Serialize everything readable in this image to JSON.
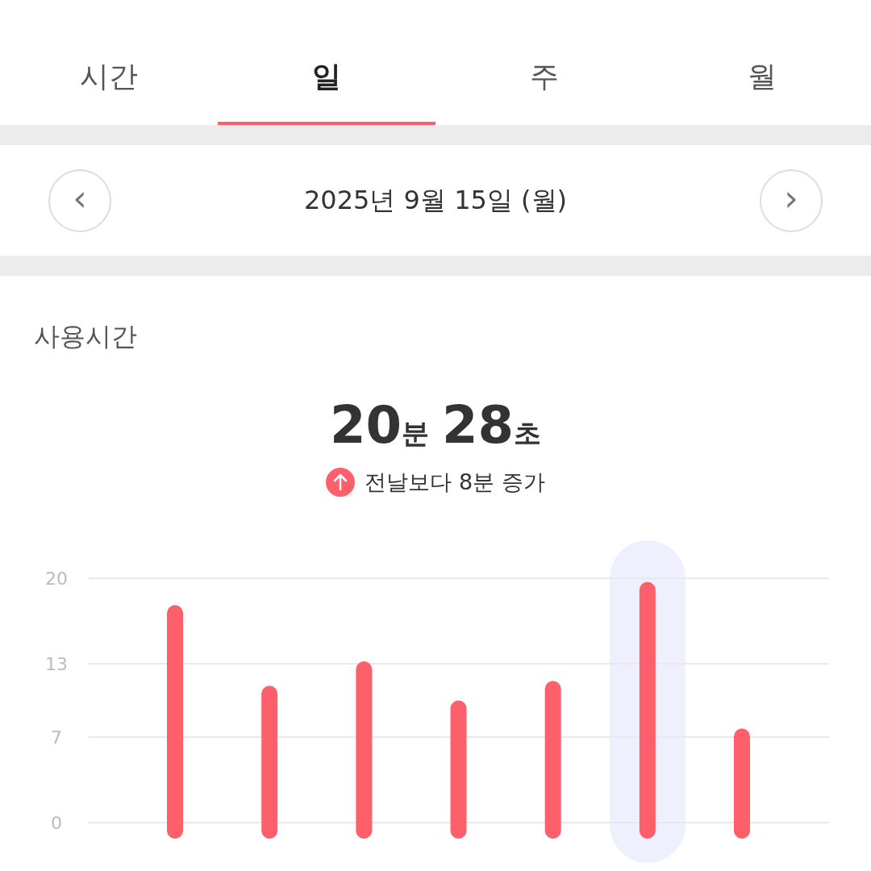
{
  "tabs": [
    {
      "label": "시간",
      "selected": false
    },
    {
      "label": "일",
      "selected": true
    },
    {
      "label": "주",
      "selected": false
    },
    {
      "label": "월",
      "selected": false
    }
  ],
  "date_nav": {
    "prev": "‹",
    "date": "2025년 9월 15일 (월)",
    "next": "›"
  },
  "usage": {
    "title": "사용시간",
    "total": [
      {
        "kind": "number",
        "text": "20"
      },
      {
        "kind": "unit",
        "text": "분"
      },
      {
        "kind": "number",
        "text": "28"
      },
      {
        "kind": "unit",
        "text": "초"
      }
    ],
    "comparison": {
      "increase": true,
      "text": "전날보다 8분 증가"
    },
    "day_bars": [
      {
        "selected": false
      },
      {
        "selected": false
      },
      {
        "selected": false
      },
      {
        "selected": false
      },
      {
        "selected": false
      },
      {
        "selected": true
      },
      {
        "selected": false
      }
    ],
    "chart_data": {
      "type": "bar",
      "series": [
        {
          "color": "#fd5f6b",
          "values": [
            17.8,
            11.2,
            13.2,
            10,
            11.6,
            19.7,
            7.7
          ]
        }
      ],
      "ylim": [
        0,
        20
      ],
      "yticks": [
        0,
        7,
        13,
        20
      ]
    }
  }
}
